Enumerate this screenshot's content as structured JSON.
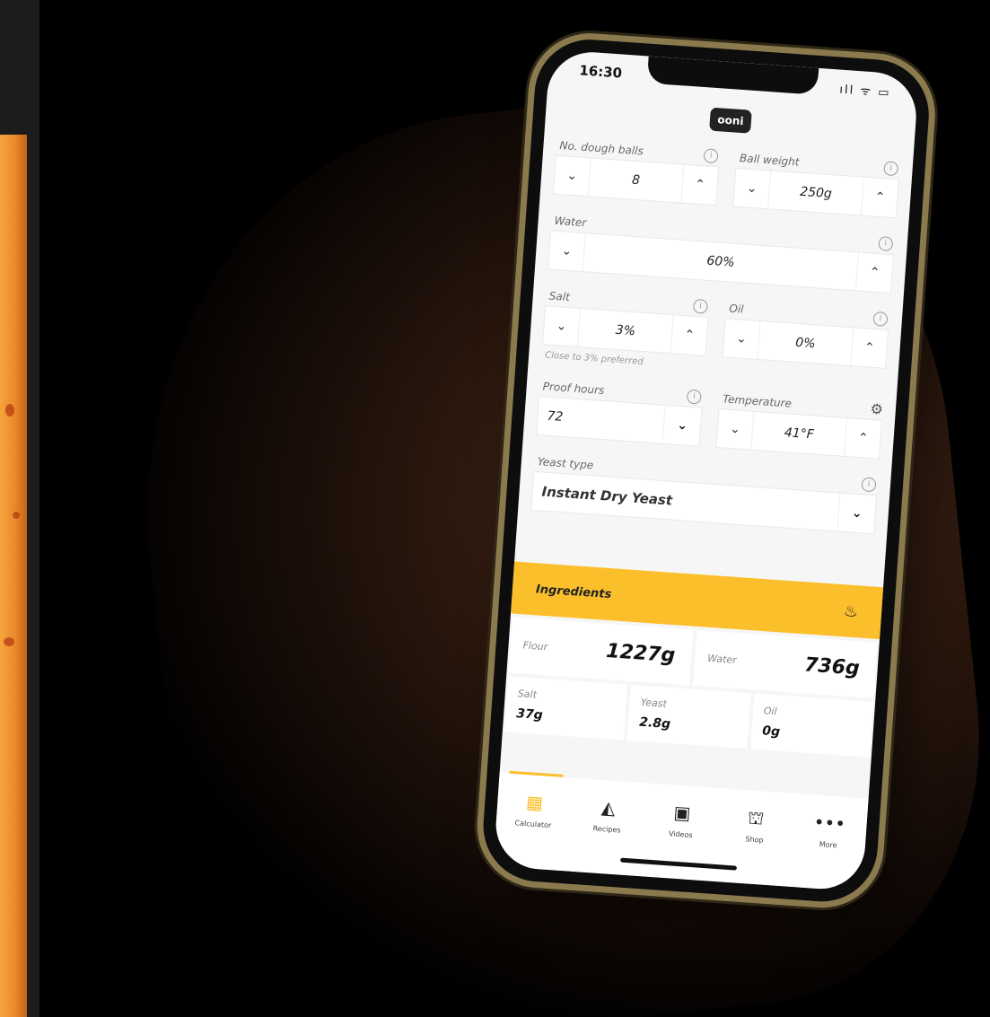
{
  "status": {
    "time": "16:30",
    "icons": "ıll ᯤ ▭"
  },
  "brand": "ooni",
  "fields": {
    "dough_balls": {
      "label": "No. dough balls",
      "value": "8"
    },
    "ball_weight": {
      "label": "Ball weight",
      "value": "250g"
    },
    "water": {
      "label": "Water",
      "value": "60%"
    },
    "salt": {
      "label": "Salt",
      "value": "3%",
      "hint": "Close to 3% preferred"
    },
    "oil": {
      "label": "Oil",
      "value": "0%"
    },
    "proof_hours": {
      "label": "Proof hours",
      "value": "72"
    },
    "temperature": {
      "label": "Temperature",
      "value": "41°F"
    },
    "yeast_type": {
      "label": "Yeast type",
      "value": "Instant Dry Yeast"
    }
  },
  "ingredients": {
    "title": "Ingredients",
    "flour": {
      "label": "Flour",
      "value": "1227g"
    },
    "water": {
      "label": "Water",
      "value": "736g"
    },
    "salt": {
      "label": "Salt",
      "value": "37g"
    },
    "yeast": {
      "label": "Yeast",
      "value": "2.8g"
    },
    "oil": {
      "label": "Oil",
      "value": "0g"
    }
  },
  "tabs": [
    {
      "label": "Calculator",
      "icon": "calculator-icon"
    },
    {
      "label": "Recipes",
      "icon": "pizza-slice-icon"
    },
    {
      "label": "Videos",
      "icon": "tv-icon"
    },
    {
      "label": "Shop",
      "icon": "basket-icon"
    },
    {
      "label": "More",
      "icon": "more-dots-icon"
    }
  ],
  "colors": {
    "accent": "#fbbf2c",
    "screen_bg": "#f6f6f6",
    "phone_frame": "#8a7a4e"
  }
}
